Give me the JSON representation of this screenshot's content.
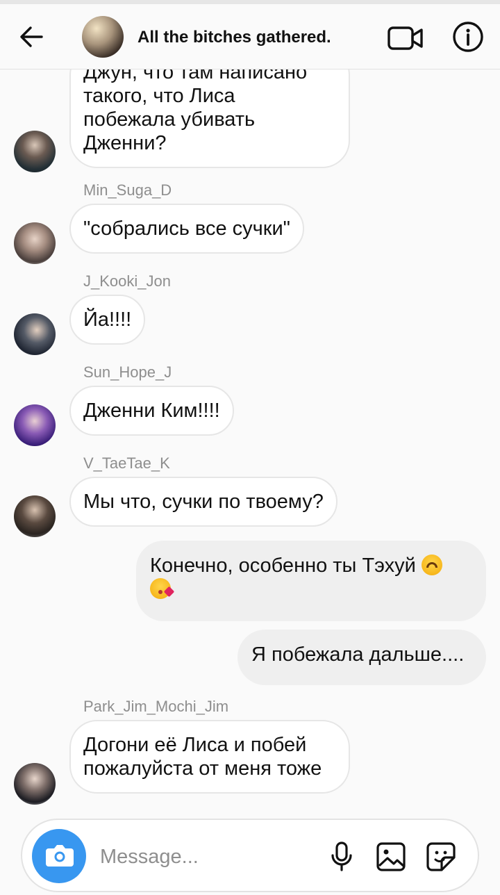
{
  "header": {
    "title": "All the bitches gathered.",
    "icons": [
      "back-arrow-icon",
      "group-avatar",
      "video-call-icon",
      "info-icon"
    ]
  },
  "messages": [
    {
      "direction": "in",
      "sender": "",
      "lines": [
        "Джун, что там написано",
        "такого, что Лиса",
        "побежала убивать",
        "Дженни?"
      ]
    },
    {
      "direction": "in",
      "sender": "Min_Suga_D",
      "text": "\"собрались все сучки\""
    },
    {
      "direction": "in",
      "sender": "J_Kooki_Jon",
      "text": "Йа!!!!"
    },
    {
      "direction": "in",
      "sender": "Sun_Hope_J",
      "text": "Дженни Ким!!!!"
    },
    {
      "direction": "in",
      "sender": "V_TaeTae_K",
      "text": "Мы что, сучки по твоему?"
    },
    {
      "direction": "out",
      "lines": [
        "Конечно, особенно ты Тэхуй",
        ""
      ],
      "emojis": [
        "upside-down-face-emoji",
        "face-blowing-kiss-emoji"
      ]
    },
    {
      "direction": "out",
      "text": "Я побежала дальше...."
    },
    {
      "direction": "in",
      "sender": "Park_Jim_Mochi_Jim",
      "lines": [
        "Догони её Лиса и побей",
        "пожалуйста от меня тоже"
      ]
    }
  ],
  "composer": {
    "placeholder": "Message...",
    "icons": [
      "camera-icon",
      "microphone-icon",
      "gallery-icon",
      "sticker-icon"
    ],
    "accent": "#3897f0"
  }
}
